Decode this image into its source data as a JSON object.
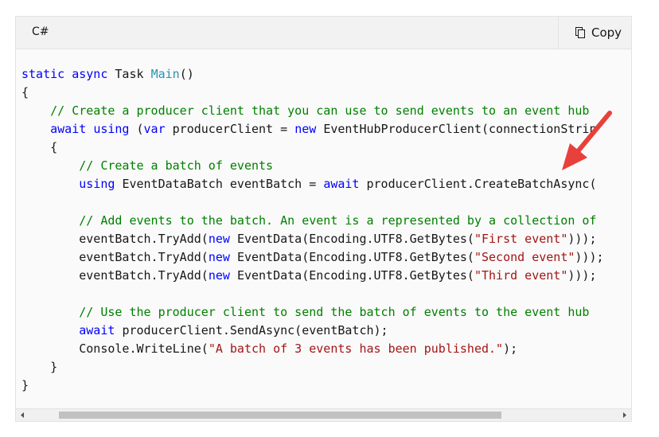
{
  "header": {
    "language": "C#",
    "copy_label": "Copy"
  },
  "code": {
    "l1_kw1": "static",
    "l1_kw2": "async",
    "l1_type": "Task",
    "l1_method": "Main",
    "l1_rest": "()",
    "l2": "{",
    "l3_comment": "// Create a producer client that you can use to send events to an event hub",
    "l4_kw1": "await",
    "l4_kw2": "using",
    "l4_p1": "(",
    "l4_kw3": "var",
    "l4_p2": "producerClient =",
    "l4_kw4": "new",
    "l4_p3": "EventHubProducerClient(connectionStrin",
    "l5": "{",
    "l6_comment": "// Create a batch of events",
    "l7_kw": "using",
    "l7_p1": "EventDataBatch eventBatch =",
    "l7_kw2": "await",
    "l7_p2": "producerClient.CreateBatchAsync(",
    "l9_comment": "// Add events to the batch. An event is a represented by a collection of",
    "l10_p1": "eventBatch.TryAdd(",
    "l10_kw": "new",
    "l10_p2": "EventData(Encoding.UTF8.GetBytes(",
    "l10_str": "\"First event\"",
    "l10_p3": ")));",
    "l11_p1": "eventBatch.TryAdd(",
    "l11_kw": "new",
    "l11_p2": "EventData(Encoding.UTF8.GetBytes(",
    "l11_str": "\"Second event\"",
    "l11_p3": ")));",
    "l12_p1": "eventBatch.TryAdd(",
    "l12_kw": "new",
    "l12_p2": "EventData(Encoding.UTF8.GetBytes(",
    "l12_str": "\"Third event\"",
    "l12_p3": ")));",
    "l14_comment": "// Use the producer client to send the batch of events to the event hub",
    "l15_kw": "await",
    "l15_p1": "producerClient.SendAsync(eventBatch);",
    "l16_p1": "Console.WriteLine(",
    "l16_str": "\"A batch of 3 events has been published.\"",
    "l16_p2": ");",
    "l17": "}",
    "l18": "}"
  },
  "colors": {
    "keyword": "#0101fd",
    "comment": "#008000",
    "string": "#a31515",
    "type": "#2b91af",
    "arrow": "#e8403a"
  },
  "icons": {
    "copy": "copy-icon",
    "scroll_left": "triangle-left-icon",
    "scroll_right": "triangle-right-icon",
    "annotation": "red-arrow-annotation"
  }
}
